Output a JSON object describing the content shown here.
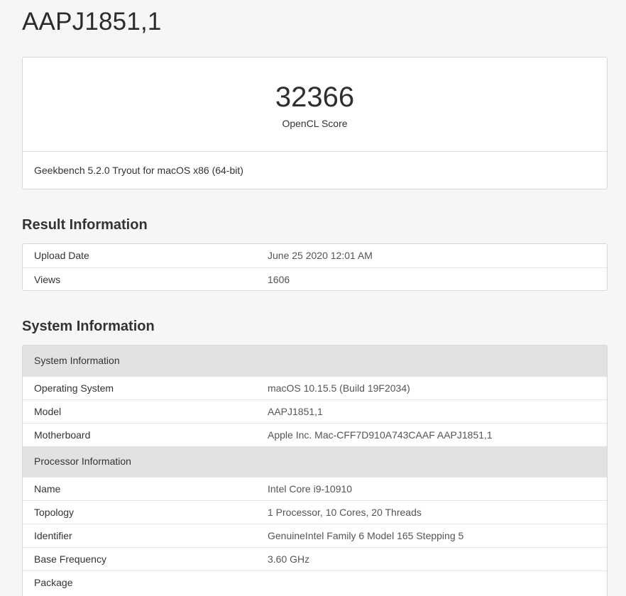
{
  "title": "AAPJ1851,1",
  "score": {
    "value": "32366",
    "label": "OpenCL Score",
    "version": "Geekbench 5.2.0 Tryout for macOS x86 (64-bit)"
  },
  "result_info": {
    "heading": "Result Information",
    "rows": [
      {
        "key": "Upload Date",
        "value": "June 25 2020 12:01 AM"
      },
      {
        "key": "Views",
        "value": "1606"
      }
    ]
  },
  "system_info": {
    "heading": "System Information",
    "groups": [
      {
        "title": "System Information",
        "rows": [
          {
            "key": "Operating System",
            "value": "macOS 10.15.5 (Build 19F2034)"
          },
          {
            "key": "Model",
            "value": "AAPJ1851,1"
          },
          {
            "key": "Motherboard",
            "value": "Apple Inc. Mac-CFF7D910A743CAAF AAPJ1851,1"
          }
        ]
      },
      {
        "title": "Processor Information",
        "rows": [
          {
            "key": "Name",
            "value": "Intel Core i9-10910"
          },
          {
            "key": "Topology",
            "value": "1 Processor, 10 Cores, 20 Threads"
          },
          {
            "key": "Identifier",
            "value": "GenuineIntel Family 6 Model 165 Stepping 5"
          },
          {
            "key": "Base Frequency",
            "value": "3.60 GHz"
          },
          {
            "key": "Package",
            "value": ""
          }
        ]
      }
    ]
  }
}
